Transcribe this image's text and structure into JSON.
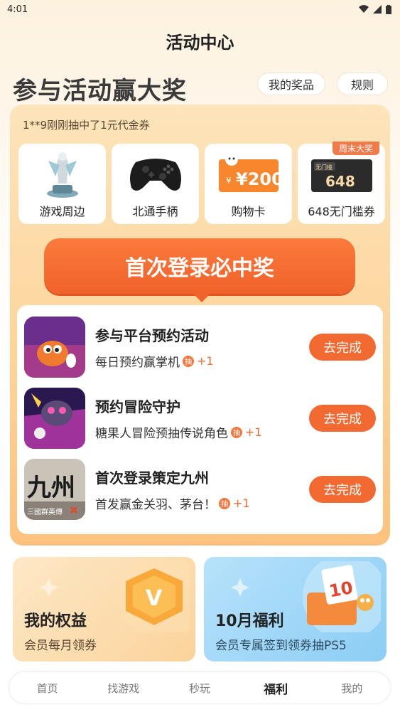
{
  "status": {
    "time": "4:01"
  },
  "header": {
    "title": "活动中心"
  },
  "hero": {
    "title": "参与活动赢大奖",
    "my_prizes_label": "我的奖品",
    "rules_label": "规则"
  },
  "prize_panel": {
    "ticker": "1**9刚刚抽中了1元代金券",
    "prizes": [
      {
        "label": "游戏周边",
        "icon": "figurine-icon"
      },
      {
        "label": "北通手柄",
        "icon": "gamepad-icon"
      },
      {
        "label": "购物卡",
        "icon": "shopping-card-icon",
        "art_text": "¥200"
      },
      {
        "label": "648无门槛券",
        "icon": "coupon-icon",
        "tag": "周末大奖",
        "art_badge": "无门槛",
        "art_text": "648"
      }
    ],
    "cta_label": "首次登录必中奖"
  },
  "tasks": [
    {
      "title": "参与平台预约活动",
      "desc": "每日预约赢掌机",
      "badge": "抽",
      "plus": "+1",
      "button": "去完成"
    },
    {
      "title": "预约冒险守护",
      "desc": "糖果人冒险预抽传说角色",
      "badge": "抽",
      "plus": "+1",
      "button": "去完成"
    },
    {
      "title": "首次登录策定九州",
      "desc": "首发赢金关羽、茅台！",
      "badge": "抽",
      "plus": "+1",
      "button": "去完成",
      "thumb_text": "九州",
      "thumb_sub": "三國群英傳"
    }
  ],
  "cards": {
    "rights": {
      "title": "我的权益",
      "subtitle": "会员每月领券",
      "icon_letter": "V"
    },
    "october": {
      "title": "10月福利",
      "subtitle": "会员专属签到领券抽PS5",
      "icon_number": "10"
    }
  },
  "tabbar": {
    "items": [
      "首页",
      "找游戏",
      "秒玩",
      "福利",
      "我的"
    ],
    "active": "福利"
  },
  "colors": {
    "accent": "#f26a32",
    "panel": "#fdd59c",
    "blue_card": "#8ccdf5"
  }
}
